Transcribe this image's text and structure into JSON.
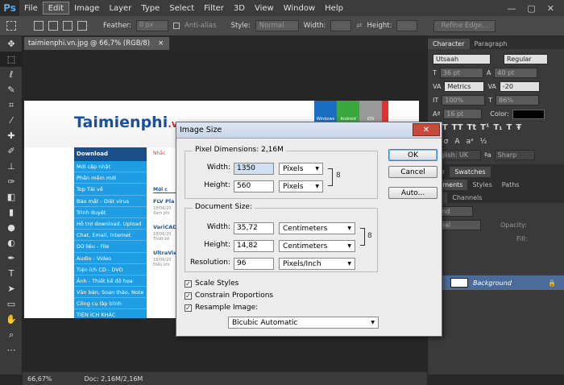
{
  "menubar": {
    "logo": "Ps",
    "items": [
      "File",
      "Edit",
      "Image",
      "Layer",
      "Type",
      "Select",
      "Filter",
      "3D",
      "View",
      "Window",
      "Help"
    ],
    "active": "Edit",
    "controls": [
      "—",
      "▢",
      "✕"
    ]
  },
  "options": {
    "feather_label": "Feather:",
    "feather_value": "0 px",
    "antialias": "Anti-alias",
    "style_label": "Style:",
    "style_value": "Normal",
    "width_label": "Width:",
    "height_label": "Height:",
    "refine": "Refine Edge..."
  },
  "document": {
    "tab": "taimienphi.vn.jpg @ 66,7% (RGB/8)",
    "tab_close": "×"
  },
  "webpage": {
    "logo_main": "Taimienphi",
    "logo_vn": ".vn",
    "tiles": [
      "Windows",
      "Android",
      "iOS"
    ],
    "menu_header": "Download",
    "menu_items": [
      "Mới cập nhật",
      "Phần mềm mới",
      "Top Tải về",
      "Bảo mật - Diệt virus",
      "Trình duyệt",
      "Hỗ trợ download, Upload",
      "Chat, Email, Internet",
      "Dữ liệu - File",
      "Audio - Video",
      "Tiện ích CD - DVD",
      "Ảnh - Thiết kế đồ họa",
      "Văn bản, Soạn thảo, Note",
      "Công cụ lập trình",
      "TIỆN ÍCH KHÁC"
    ],
    "articles": [
      {
        "title": "FLV Pla",
        "date": "18/06/20",
        "sub": "Xem phi"
      },
      {
        "title": "VariCAD",
        "date": "18/06/20",
        "sub": "Thiết kế"
      },
      {
        "title": "UltraVie",
        "date": "18/06/20",
        "sub": "Điều khi"
      }
    ],
    "side_tab": "Mới c",
    "side_note": "Nhắc"
  },
  "right_panel": {
    "tabs1": [
      "Character",
      "Paragraph"
    ],
    "font": "Utsaah",
    "font_style": "Regular",
    "size": "36 pt",
    "leading": "40 pt",
    "kerning": "Metrics",
    "tracking": "-20",
    "vscale": "100%",
    "hscale": "86%",
    "baseline": "16 pt",
    "color_label": "Color:",
    "language": "nglish: UK",
    "aa": "Sharp",
    "tabs2": [
      "olor",
      "Swatches"
    ],
    "tabs3": [
      "ustments",
      "Styles",
      "Paths"
    ],
    "tabs4": [
      "ers",
      "Channels"
    ],
    "kind": "Kind",
    "blend": "rmal",
    "opacity_label": "Opacity:",
    "fill_label": "Fill:",
    "layer_name": "Background"
  },
  "status": {
    "zoom": "66,67%",
    "doc": "Doc: 2,16M/2,16M"
  },
  "dialog": {
    "title": "Image Size",
    "pixel_dimensions": "Pixel Dimensions:  2,16M",
    "width_label": "Width:",
    "width_px": "1350",
    "width_px_unit": "Pixels",
    "height_label": "Height:",
    "height_px": "560",
    "height_px_unit": "Pixels",
    "document_size": "Document Size:",
    "doc_width": "35,72",
    "doc_width_unit": "Centimeters",
    "doc_height": "14,82",
    "doc_height_unit": "Centimeters",
    "resolution_label": "Resolution:",
    "resolution": "96",
    "resolution_unit": "Pixels/Inch",
    "scale_styles": "Scale Styles",
    "constrain": "Constrain Proportions",
    "resample": "Resample Image:",
    "resample_method": "Bicubic Automatic",
    "ok": "OK",
    "cancel": "Cancel",
    "auto": "Auto..."
  }
}
